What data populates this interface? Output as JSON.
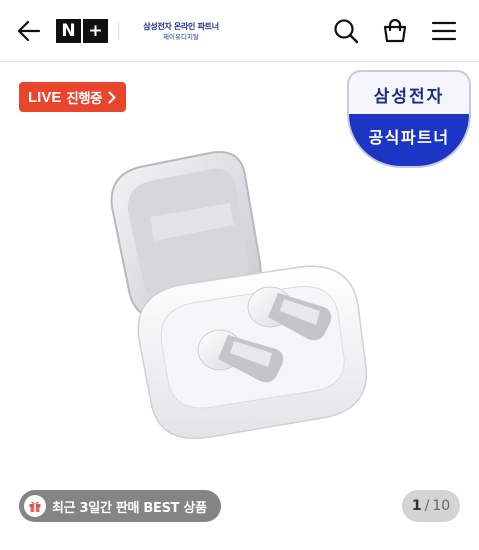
{
  "header": {
    "logo_text": "N+",
    "store_line1": "삼성전자 온라인 파트너",
    "store_line2": "제이유디지탈",
    "icons": [
      "back-arrow-icon",
      "search-icon",
      "shopping-bag-icon",
      "hamburger-menu-icon"
    ]
  },
  "hero": {
    "live_badge": {
      "word": "LIVE",
      "status": "진행중",
      "color": "#e9452d"
    },
    "seal": {
      "top_text": "삼성전자",
      "bottom_text": "공식파트너",
      "top_color": "#1a2a8a",
      "bottom_color": "#1c35c5"
    },
    "best_chip": {
      "label": "최근 3일간 판매 BEST 상품",
      "icon": "gift-icon"
    },
    "pager": {
      "current": "1",
      "separator": "/",
      "total": "10"
    }
  }
}
